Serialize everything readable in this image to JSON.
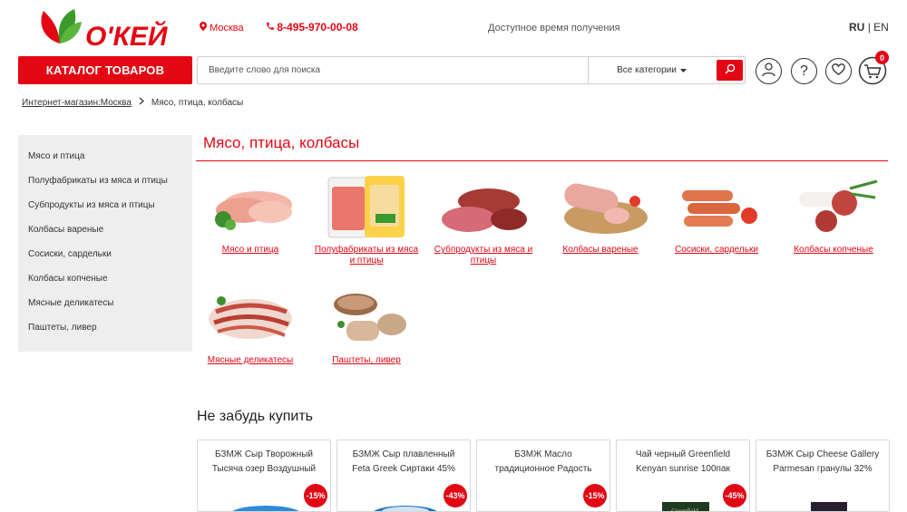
{
  "header": {
    "city": "Москва",
    "phone": "8-495-970-00-08",
    "pickup_label": "Доступное время получения",
    "lang_current": "RU",
    "lang_sep": "|",
    "lang_other": "EN",
    "logo_text": "О'КЕЙ"
  },
  "toolbar": {
    "catalog_label": "КАТАЛОГ ТОВАРОВ",
    "search_placeholder": "Введите слово для поиска",
    "category_select": "Все категории",
    "cart_count": "0"
  },
  "breadcrumb": {
    "home": "Интернет-магазин:Москва",
    "current": "Мясо, птица, колбасы"
  },
  "sidebar": {
    "items": [
      {
        "label": "Мясо и птица"
      },
      {
        "label": "Полуфабрикаты из мяса и птицы"
      },
      {
        "label": "Субпродукты из мяса и птицы"
      },
      {
        "label": "Колбасы вареные"
      },
      {
        "label": "Сосиски, сардельки"
      },
      {
        "label": "Колбасы копченые"
      },
      {
        "label": "Мясные деликатесы"
      },
      {
        "label": "Паштеты, ливер"
      }
    ]
  },
  "main": {
    "title": "Мясо, птица, колбасы",
    "categories": [
      {
        "line1": "Мясо и птица",
        "line2": ""
      },
      {
        "line1": "Полуфабрикаты из мяса",
        "line2": "и птицы"
      },
      {
        "line1": "Субпродукты из мяса и",
        "line2": "птицы"
      },
      {
        "line1": "Колбасы вареные",
        "line2": ""
      },
      {
        "line1": "Сосиски, сардельки",
        "line2": ""
      },
      {
        "line1": "Колбасы копченые",
        "line2": ""
      },
      {
        "line1": "Мясные деликатесы",
        "line2": ""
      },
      {
        "line1": "Паштеты, ливер",
        "line2": ""
      }
    ],
    "dont_forget_title": "Не забудь купить",
    "products": [
      {
        "line1": "БЗМЖ Сыр Творожный",
        "line2": "Тысяча озер Воздушный",
        "discount": "-15%"
      },
      {
        "line1": "БЗМЖ Сыр плавленный",
        "line2": "Feta Greek Сиртаки 45%",
        "discount": "-43%"
      },
      {
        "line1": "БЗМЖ Масло",
        "line2": "традиционное Радость",
        "discount": "-15%"
      },
      {
        "line1": "Чай черный Greenfield",
        "line2": "Kenyan sunrise 100пак",
        "discount": "-45%"
      },
      {
        "line1": "БЗМЖ Сыр Cheese Gallery",
        "line2": "Parmesan гранулы 32%",
        "discount": ""
      }
    ]
  },
  "colors": {
    "accent": "#e30613",
    "leaf_green": "#3a9a2b",
    "sidebar_bg": "#eeeeee"
  }
}
